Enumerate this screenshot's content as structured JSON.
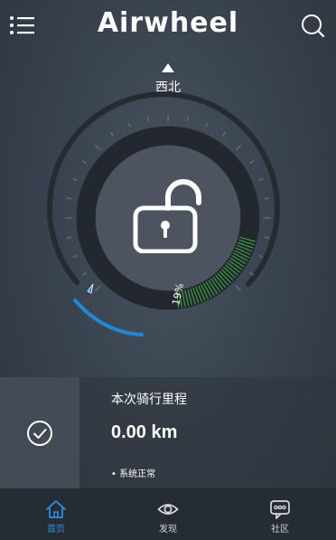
{
  "header": {
    "brand": "Airwheel",
    "menu_icon": "menu-icon",
    "search_icon": "search-icon"
  },
  "heading": {
    "direction": "西北",
    "arrow_icon": "triangle-up-icon"
  },
  "gauge": {
    "battery_percent_label": "19%",
    "battery_percent": 19,
    "lock_state": "unlocked",
    "lock_icon": "unlocked-padlock-icon",
    "colors": {
      "track": "#2a2f35",
      "battery": "#3fae3f",
      "speed_arc": "#1e8fe6"
    }
  },
  "ride": {
    "status_icon": "check-circle-icon",
    "title": "本次骑行里程",
    "distance": "0.00 km",
    "system_status": "• 系统正常"
  },
  "tabs": [
    {
      "label": "首页",
      "icon": "home-icon",
      "active": true
    },
    {
      "label": "发现",
      "icon": "eye-icon",
      "active": false
    },
    {
      "label": "社区",
      "icon": "chat-bubble-icon",
      "active": false
    }
  ],
  "colors": {
    "accent": "#2a8fe0",
    "tabbar_bg": "#262c33"
  }
}
